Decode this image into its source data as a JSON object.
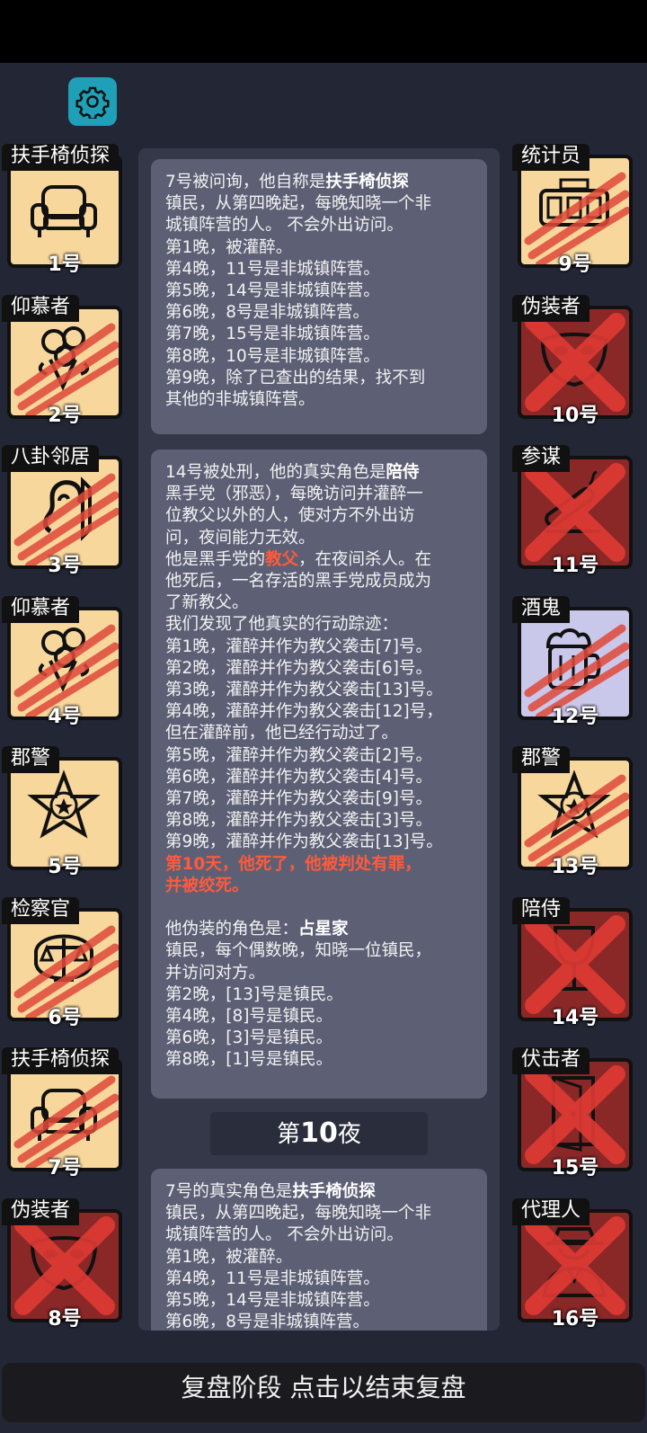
{
  "settings": {
    "icon": "gear-icon"
  },
  "left_players": [
    {
      "role": "扶手椅侦探",
      "number": "1号",
      "side": "good",
      "dead": false,
      "icon": "armchair-icon"
    },
    {
      "role": "仰慕者",
      "number": "2号",
      "side": "good",
      "dead": true,
      "icon": "bouquet-icon"
    },
    {
      "role": "八卦邻居",
      "number": "3号",
      "side": "good",
      "dead": true,
      "icon": "ear-icon"
    },
    {
      "role": "仰慕者",
      "number": "4号",
      "side": "good",
      "dead": true,
      "icon": "bouquet-icon"
    },
    {
      "role": "郡警",
      "number": "5号",
      "side": "good",
      "dead": false,
      "icon": "sheriff-star-icon"
    },
    {
      "role": "检察官",
      "number": "6号",
      "side": "good",
      "dead": true,
      "icon": "scales-icon"
    },
    {
      "role": "扶手椅侦探",
      "number": "7号",
      "side": "good",
      "dead": true,
      "icon": "armchair-icon"
    },
    {
      "role": "伪装者",
      "number": "8号",
      "side": "evil",
      "dead": true,
      "icon": "mask-icon"
    }
  ],
  "right_players": [
    {
      "role": "统计员",
      "number": "9号",
      "side": "good",
      "dead": true,
      "icon": "counter-icon"
    },
    {
      "role": "伪装者",
      "number": "10号",
      "side": "evil",
      "dead": true,
      "icon": "mask-icon"
    },
    {
      "role": "参谋",
      "number": "11号",
      "side": "evil",
      "dead": true,
      "icon": "cigar-icon"
    },
    {
      "role": "酒鬼",
      "number": "12号",
      "side": "drunk",
      "dead": true,
      "icon": "beer-mug-icon"
    },
    {
      "role": "郡警",
      "number": "13号",
      "side": "good",
      "dead": true,
      "icon": "sheriff-star-icon"
    },
    {
      "role": "陪侍",
      "number": "14号",
      "side": "evil",
      "dead": true,
      "icon": "wine-glass-icon"
    },
    {
      "role": "伏击者",
      "number": "15号",
      "side": "evil",
      "dead": true,
      "icon": "door-icon"
    },
    {
      "role": "代理人",
      "number": "16号",
      "side": "evil",
      "dead": true,
      "icon": "gangster-icon"
    }
  ],
  "messages": [
    {
      "lines": [
        [
          "7号被问询，他自称是",
          "扶手椅侦探"
        ],
        [
          "镇民，从第四晚起，每晚知晓一个非"
        ],
        [
          "城镇阵营的人。 不会外出访问。"
        ],
        [
          "第1晚，被灌醉。"
        ],
        [
          "第4晚，11号是非城镇阵营。"
        ],
        [
          "第5晚，14号是非城镇阵营。"
        ],
        [
          "第6晚，8号是非城镇阵营。"
        ],
        [
          "第7晚，15号是非城镇阵营。"
        ],
        [
          "第8晚，10号是非城镇阵营。"
        ],
        [
          "第9晚，除了已查出的结果，找不到"
        ],
        [
          "其他的非城镇阵营。"
        ]
      ]
    },
    {
      "lines": [
        [
          "14号被处刑，他的真实角色是",
          "陪侍"
        ],
        [
          "黑手党（邪恶），每晚访问并灌醉一"
        ],
        [
          "位教父以外的人，使对方不外出访"
        ],
        [
          "问，夜间能力无效。"
        ],
        [
          "他是黑手党的",
          "教父",
          "，在夜间杀人。在"
        ],
        [
          "他死后，一名存活的黑手党成员成为"
        ],
        [
          "了新教父。"
        ],
        [
          "我们发现了他真实的行动踪迹："
        ],
        [
          "第1晚，灌醉并作为教父袭击[7]号。"
        ],
        [
          "第2晚，灌醉并作为教父袭击[6]号。"
        ],
        [
          "第3晚，灌醉并作为教父袭击[13]号。"
        ],
        [
          "第4晚，灌醉并作为教父袭击[12]号，"
        ],
        [
          "但在灌醉前，他已经行动过了。"
        ],
        [
          "第5晚，灌醉并作为教父袭击[2]号。"
        ],
        [
          "第6晚，灌醉并作为教父袭击[4]号。"
        ],
        [
          "第7晚，灌醉并作为教父袭击[9]号。"
        ],
        [
          "第8晚，灌醉并作为教父袭击[3]号。"
        ],
        [
          "第9晚，灌醉并作为教父袭击[13]号。"
        ],
        [
          "第10天，他死了，他被判处有罪，"
        ],
        [
          "并被绞死。"
        ],
        [
          ""
        ],
        [
          "他伪装的角色是：",
          "占星家"
        ],
        [
          "镇民，每个偶数晚，知晓一位镇民，"
        ],
        [
          "并访问对方。"
        ],
        [
          "第2晚，[13]号是镇民。"
        ],
        [
          "第4晚，[8]号是镇民。"
        ],
        [
          "第6晚，[3]号是镇民。"
        ],
        [
          "第8晚，[1]号是镇民。"
        ]
      ]
    },
    {
      "lines": [
        [
          "7号的真实角色是",
          "扶手椅侦探"
        ],
        [
          "镇民，从第四晚起，每晚知晓一个非"
        ],
        [
          "城镇阵营的人。 不会外出访问。"
        ],
        [
          "第1晚，被灌醉。"
        ],
        [
          "第4晚，11号是非城镇阵营。"
        ],
        [
          "第5晚，14号是非城镇阵营。"
        ],
        [
          "第6晚，8号是非城镇阵营。"
        ]
      ]
    }
  ],
  "night_header": {
    "prefix": "第",
    "number": "10",
    "suffix": "夜"
  },
  "bottom_bar": {
    "label": "复盘阶段 点击以结束复盘"
  },
  "colors": {
    "good_tile": "#f8d79c",
    "evil_tile": "#8a2727",
    "drunk_tile": "#c9c7ea",
    "highlight_red": "#ff5a3c",
    "settings_teal": "#1fa0b8"
  }
}
